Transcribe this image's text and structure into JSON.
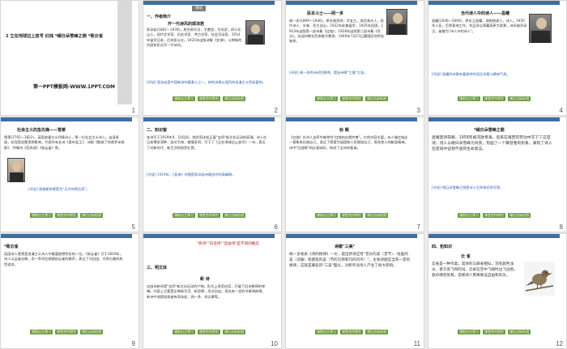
{
  "slides": [
    {
      "num": "1",
      "title": "2  立在地球边上放号  红烛  *峨日朵雪峰之侧 *致云雀",
      "logo": "第一PPT模板网-WWW.1PPT.COM"
    },
    {
      "num": "2",
      "tag": "课前",
      "section": "一、作者简介",
      "heading": "开一代诗风的郭沫若",
      "body": "郭沫若(1892—1978)，原名郭开贞，字鼎堂，号尚武，四川乐山人。现代文学家、历史学家、考古学家、社会活动家。1914年留学日本，后弃医从文。1921年出版诗集《女神》，以崭新的内容和形式开一代诗风。",
      "note": "[评说] 郭沫若是中国新诗的奠基人之一，他的诗歌以强烈的浪漫主义色彩著称。"
    },
    {
      "num": "3",
      "heading": "民本斗士——闻一多",
      "body": "闻一多(1899—1946)，原名闻家骅，字友三，湖北浠水人，现代诗人、学者、民主战士。1922年赴美留学，1925年回国，1923年出版第一部诗集《红烛》，1928年出版第二部诗集《死水》。抗战时期任西南联大教授，1946年7月15日遭国民党特务暗杀。",
      "note": "[评说] 闻一多的诗讲究格律，提出诗歌\"三美\"主张。"
    },
    {
      "num": "4",
      "heading": "当代诗人中的诗人——昌耀",
      "body": "昌耀(1936—2000)，原名王昌耀，湖南桃源人，诗人。1950年入伍，后到青海工作，作品多以青藏高原为背景，诗风雄浑深沉，被誉为\"诗人中的诗人\"。",
      "note": "[评说] 昌耀的诗歌有着独特的语言风格与精神气质。"
    },
    {
      "num": "5",
      "heading": "社会主义的急先锋——雪莱",
      "body": "雪莱(1792—1822)，英国浪漫主义抒情诗人，第一位社会主义诗人。出身贵族，却深受启蒙思想影响，代表作有长诗《麦布女王》、诗剧《解放了的普罗米修斯》、抒情诗《西风颂》《致云雀》等。",
      "note": "[评说] 恩格斯称雪莱为\"天才的预言家\"。"
    },
    {
      "num": "6",
      "section": "二、知识窗",
      "body": "本诗写于1919年9、10月间，其时郭沫若正值\"五四\"新文化运动的高潮。诗人在日本博多湾畔，面对大海，激情澎湃，写下了《立在地球边上放号》一诗，表达了对新时代、新生活的热烈礼赞。",
      "note": "[评说] 1919年，《女神》时期是郭沫若诗歌创作的高峰期。"
    },
    {
      "num": "7",
      "heading": "标  题",
      "body": "《红烛》在诗人自序中被称为\"红烛的自我完善\"。它的内容丰富，诗人借红烛这一意象来比喻自己，表达了愿意为祖国和人民燃烧自己、照亮他人的献身精神。诗中\"红烛啊\"的反复咏叹，构成了全诗的基调。",
      "note": ""
    },
    {
      "num": "8",
      "heading": "*峨日朵雪峰之侧",
      "body": "昌耀因诗获罪，1958年被流放青海，后来在艰苦的劳动中写下了这首诗。诗人以峨日朵雪峰为背景，刻画了一个攀登者的形象，表现了诗人在逆境中坚韧不屈的生命意志。",
      "note": "[评说] 峨日朵雪峰之侧是诗人生命体验的写照。"
    },
    {
      "num": "9",
      "heading": "*致云雀",
      "body": "英国诗人雪莱是浪漫主义诗人中最富理想色彩的一位。《致云雀》写于1820年，诗人以云雀自喻，用一系列比喻描绘云雀的歌声，表达了对自由、光明与美的热烈追求。",
      "note": ""
    },
    {
      "num": "10",
      "section": "三、明文体",
      "banner": "\"新诗\"\"白话诗\"\"自由诗\"是不同的概念",
      "heading": "新  诗",
      "body": "自由诗新诗是\"五四\"新文化运动的产物，形式上采用白话，打破了旧诗格律的束缚。内容上主要是反映新生活、新思想，形式自由，但也有一定的节奏和韵律。新诗中成就较高者有郭沫若、闻一多、徐志摩等。",
      "note": ""
    },
    {
      "num": "11",
      "heading": "诗歌\"三美\"",
      "body": "闻一多发表《诗的格律》一文，提出新诗应有\"音乐的美（音节）、绘画的美（词藻）和建筑的美（节的匀称和句的均齐）\"，主张诗歌应当有一定的格律，这就是著名的\"三美\"理论，对新月派诗人产生了很大影响。",
      "note": ""
    },
    {
      "num": "12",
      "section": "四、拓知识",
      "heading": "云  雀",
      "body": "云雀是一种鸟类，其体形与麻雀相似，羽毛颜色浅淡，善于高飞和鸣叫。云雀在空中飞翔时边飞边唱，歌声嘹亮悦耳，常被诗人用来象征自由和欢乐。",
      "note": ""
    }
  ],
  "footer_buttons": [
    "课前自主预习",
    "课堂合作探究",
    "课后达标检测"
  ]
}
